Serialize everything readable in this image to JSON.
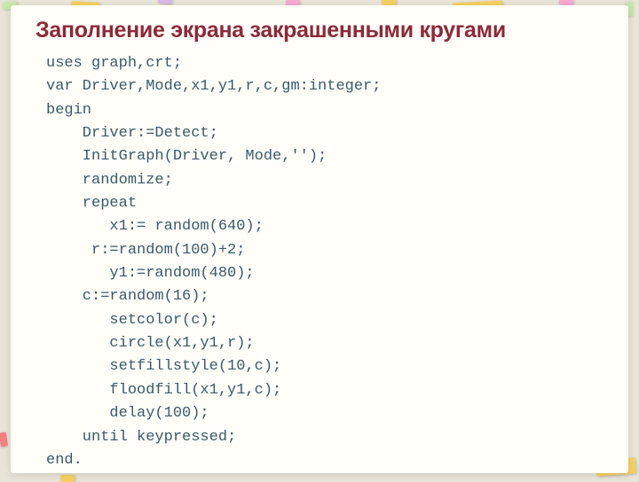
{
  "title": "Заполнение экрана закрашенными кругами",
  "code": {
    "l1": "uses graph,crt;",
    "l2": "var Driver,Mode,x1,y1,r,c,gm:integer;",
    "l3": "begin",
    "l4": "    Driver:=Detect;",
    "l5": "    InitGraph(Driver, Mode,'');",
    "l6": "    randomize;",
    "l7": "    repeat",
    "l8": "       x1:= random(640);",
    "l9": "     r:=random(100)+2;",
    "l10": "       y1:=random(480);",
    "l11": "    c:=random(16);",
    "l12": "       setcolor(c);",
    "l13": "       circle(x1,y1,r);",
    "l14": "       setfillstyle(10,c);",
    "l15": "       floodfill(x1,y1,c);",
    "l16": "       delay(100);",
    "l17": "    until keypressed;",
    "l18": "end."
  }
}
